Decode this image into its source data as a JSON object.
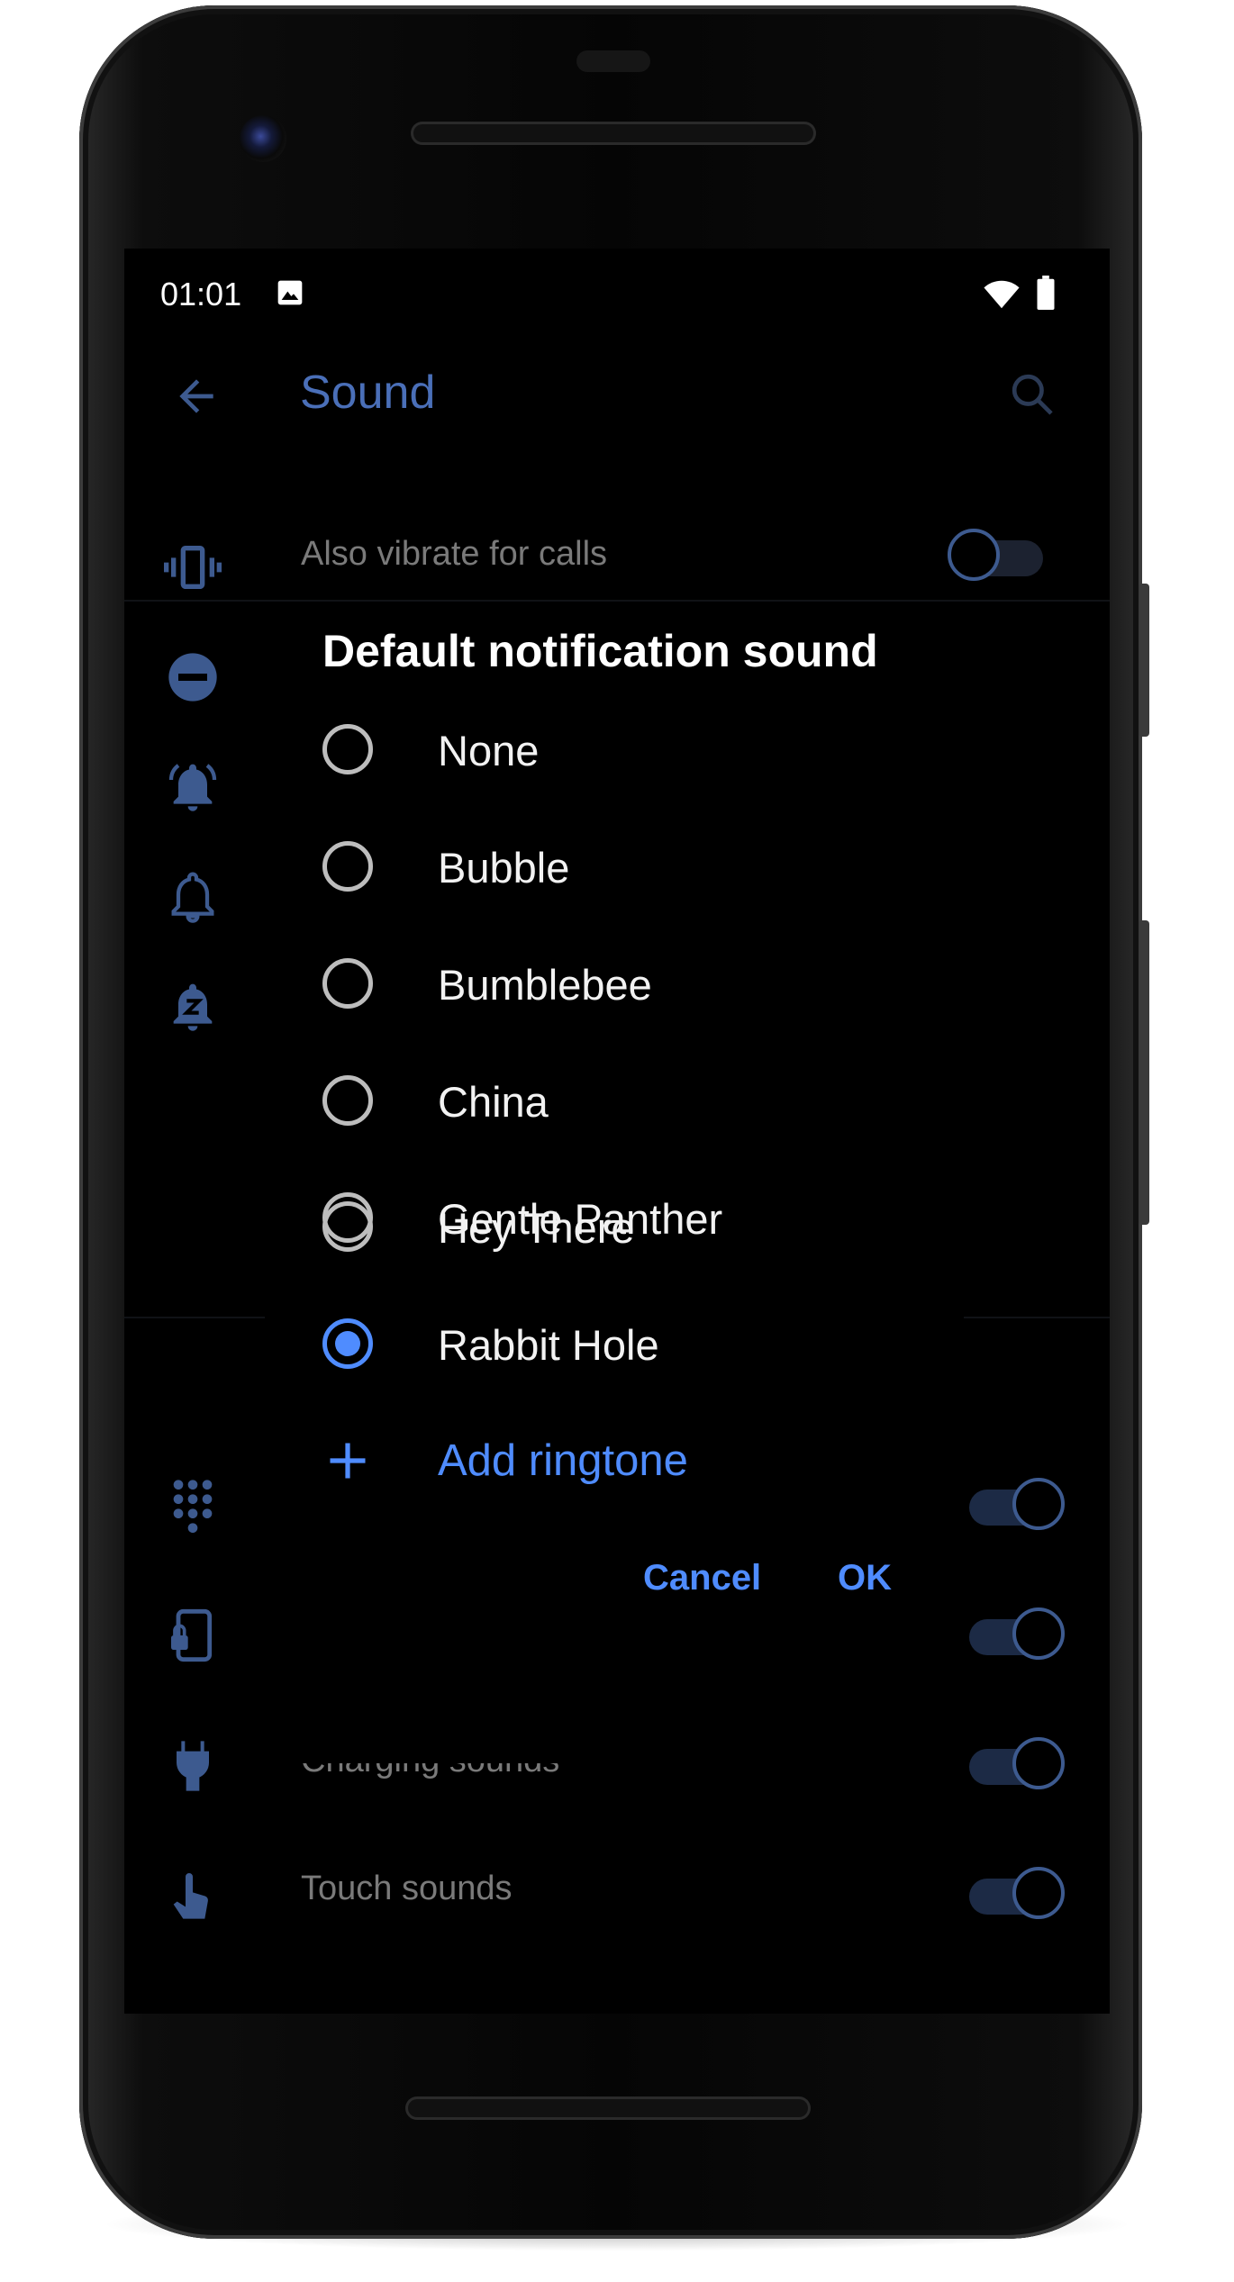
{
  "status_bar": {
    "time": "01:01",
    "notification_icon": "image-icon",
    "wifi_icon": "wifi-icon",
    "battery_icon": "battery-icon"
  },
  "background_screen": {
    "title": "Sound",
    "back_icon": "arrow-back-icon",
    "search_icon": "search-icon",
    "rows": [
      {
        "icon": "vibrate-icon",
        "label": "Also vibrate for calls",
        "toggle": "off"
      },
      {
        "icon": "do-not-disturb-icon",
        "label": "",
        "toggle": null
      },
      {
        "icon": "bell-ring-icon",
        "label": "",
        "toggle": null
      },
      {
        "icon": "bell-icon",
        "label": "",
        "toggle": null
      },
      {
        "icon": "bell-snooze-icon",
        "label": "",
        "toggle": null
      },
      {
        "icon": "dialpad-icon",
        "label": "",
        "toggle": "on"
      },
      {
        "icon": "screen-lock-icon",
        "label": "",
        "toggle": "on"
      },
      {
        "icon": "charging-plug-icon",
        "label": "Charging sounds",
        "toggle": "on"
      },
      {
        "icon": "touch-icon",
        "label": "Touch sounds",
        "toggle": "on"
      }
    ]
  },
  "dialog": {
    "title": "Default notification sound",
    "options": [
      {
        "label": "None",
        "selected": false
      },
      {
        "label": "Bubble",
        "selected": false
      },
      {
        "label": "Bumblebee",
        "selected": false
      },
      {
        "label": "China",
        "selected": false
      },
      {
        "label": "Gentle Panther",
        "selected": false
      },
      {
        "label": "Hey There",
        "selected": false
      },
      {
        "label": "Rabbit Hole",
        "selected": true
      }
    ],
    "add_ringtone_label": "Add ringtone",
    "cancel_label": "Cancel",
    "ok_label": "OK"
  },
  "colors": {
    "accent": "#4f8cff",
    "dim_accent": "#4a6fb8",
    "background": "#000000"
  }
}
